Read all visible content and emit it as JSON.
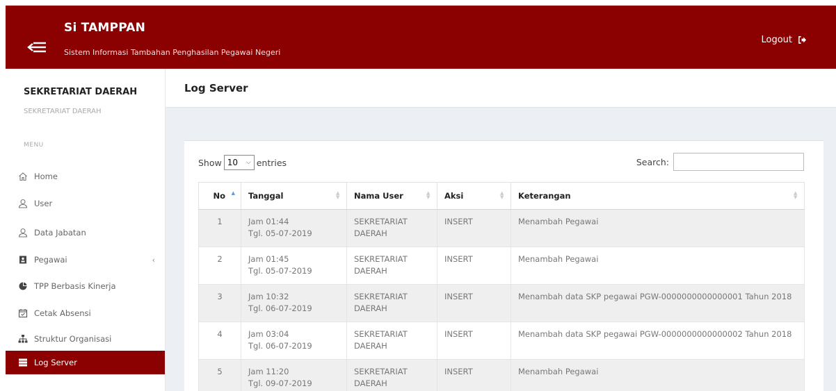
{
  "header": {
    "title": "Si TAMPPAN",
    "subtitle": "Sistem Informasi Tambahan Penghasilan Pegawai Negeri",
    "logout_label": "Logout",
    "bg_color": "#8b0000"
  },
  "sidebar": {
    "org_name": "SEKRETARIAT DAERAH",
    "org_sub": "SEKRETARIAT DAERAH",
    "menu_header": "MENU",
    "items": [
      {
        "label": "Home",
        "icon": "home-icon"
      },
      {
        "label": "User",
        "icon": "user-icon"
      },
      {
        "label": "Data Jabatan",
        "icon": "user-icon"
      },
      {
        "label": "Pegawai",
        "icon": "id-card-icon",
        "has_children": true
      },
      {
        "label": "TPP Berbasis Kinerja",
        "icon": "pie-chart-icon"
      },
      {
        "label": "Cetak Absensi",
        "icon": "calendar-check-icon"
      },
      {
        "label": "Struktur Organisasi",
        "icon": "sitemap-icon"
      },
      {
        "label": "Log Server",
        "icon": "server-icon",
        "active": true
      }
    ]
  },
  "main": {
    "page_title": "Log Server",
    "length": {
      "show_label": "Show",
      "value": "10",
      "entries_label": "entries"
    },
    "search_label": "Search:",
    "table": {
      "columns": [
        "No",
        "Tanggal",
        "Nama User",
        "Aksi",
        "Keterangan"
      ],
      "rows": [
        {
          "no": "1",
          "jam": "Jam 01:44",
          "tgl": "Tgl. 05-07-2019",
          "user": "SEKRETARIAT DAERAH",
          "aksi": "INSERT",
          "ket": "Menambah Pegawai"
        },
        {
          "no": "2",
          "jam": "Jam 01:45",
          "tgl": "Tgl. 05-07-2019",
          "user": "SEKRETARIAT DAERAH",
          "aksi": "INSERT",
          "ket": "Menambah Pegawai"
        },
        {
          "no": "3",
          "jam": "Jam 10:32",
          "tgl": "Tgl. 06-07-2019",
          "user": "SEKRETARIAT DAERAH",
          "aksi": "INSERT",
          "ket": "Menambah data SKP pegawai PGW-0000000000000001 Tahun 2018"
        },
        {
          "no": "4",
          "jam": "Jam 03:04",
          "tgl": "Tgl. 06-07-2019",
          "user": "SEKRETARIAT DAERAH",
          "aksi": "INSERT",
          "ket": "Menambah data SKP pegawai PGW-0000000000000002 Tahun 2018"
        },
        {
          "no": "5",
          "jam": "Jam 11:20",
          "tgl": "Tgl. 09-07-2019",
          "user": "SEKRETARIAT DAERAH",
          "aksi": "INSERT",
          "ket": "Menambah Pegawai"
        }
      ]
    }
  }
}
